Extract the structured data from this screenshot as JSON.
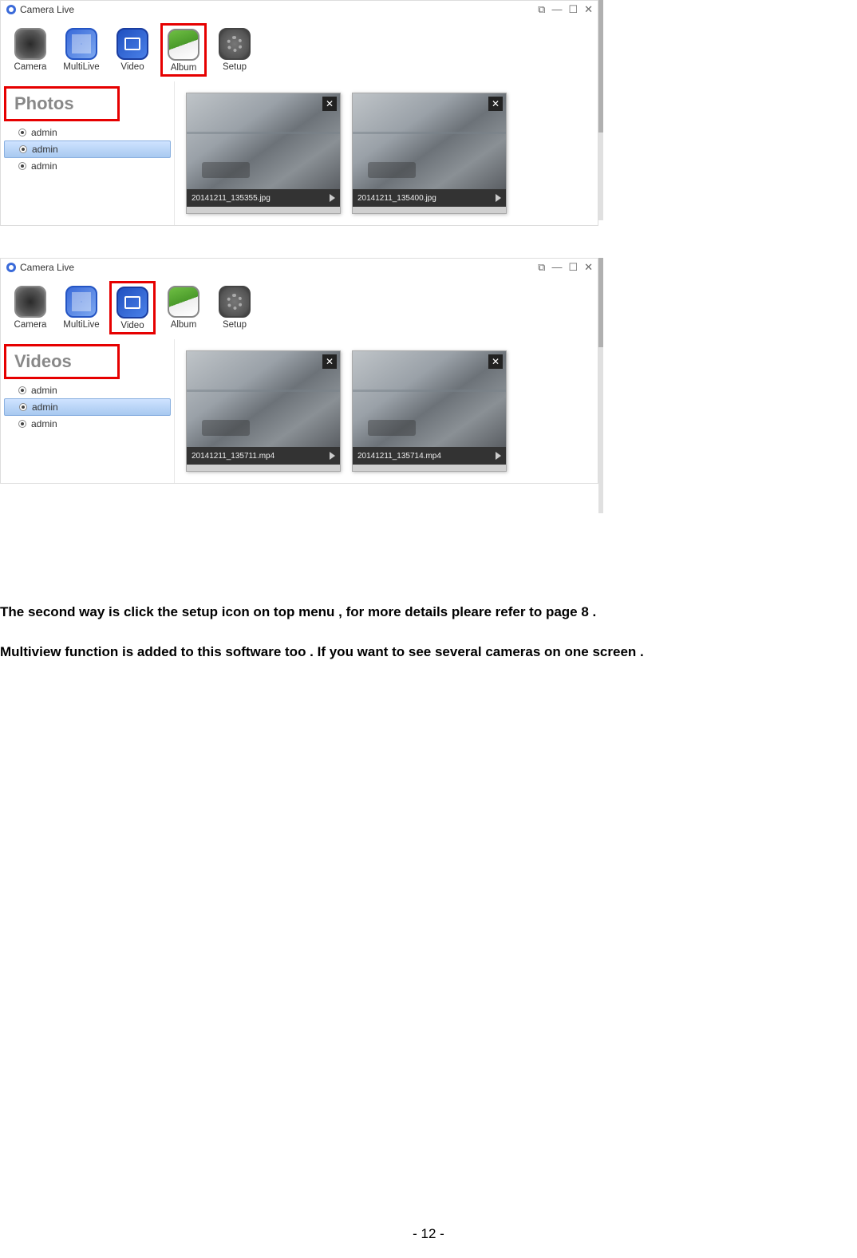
{
  "app1": {
    "title": "Camera Live",
    "toolbar": [
      {
        "label": "Camera"
      },
      {
        "label": "MultiLive"
      },
      {
        "label": "Video"
      },
      {
        "label": "Album"
      },
      {
        "label": "Setup"
      }
    ],
    "sidebar_title": "Photos",
    "sidebar_items": [
      "admin",
      "admin",
      "admin"
    ],
    "thumbs": [
      {
        "filename": "20141211_135355.jpg"
      },
      {
        "filename": "20141211_135400.jpg"
      }
    ]
  },
  "app2": {
    "title": "Camera Live",
    "toolbar": [
      {
        "label": "Camera"
      },
      {
        "label": "MultiLive"
      },
      {
        "label": "Video"
      },
      {
        "label": "Album"
      },
      {
        "label": "Setup"
      }
    ],
    "sidebar_title": "Videos",
    "sidebar_items": [
      "admin",
      "admin",
      "admin"
    ],
    "thumbs": [
      {
        "filename": "20141211_135711.mp4"
      },
      {
        "filename": "20141211_135714.mp4"
      }
    ]
  },
  "body": {
    "p1": "The second way is click the setup icon on top menu , for more details pleare refer to page 8 .",
    "p2": "Multiview function is added to this software too . If you want to see several cameras on one screen ."
  },
  "page_number": "- 12 -",
  "window_controls": {
    "popout": "⧉",
    "min": "—",
    "max": "☐",
    "close": "✕"
  }
}
